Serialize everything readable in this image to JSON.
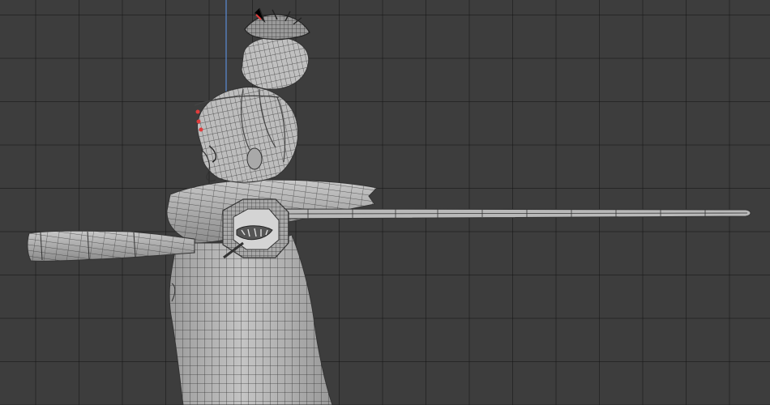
{
  "viewport": {
    "mode": "wireframe-overlay",
    "view": "side",
    "colors": {
      "background": "#3d3d3d",
      "grid": "#2a2a2a",
      "mesh_fill": "#b4b4b4",
      "mesh_shade": "#8f8f8f",
      "wire": "#3a3a3a",
      "z_axis": "#5b8bd6",
      "selection": "#e03c3c"
    }
  },
  "object": {
    "icon": "character-mesh-icon"
  }
}
